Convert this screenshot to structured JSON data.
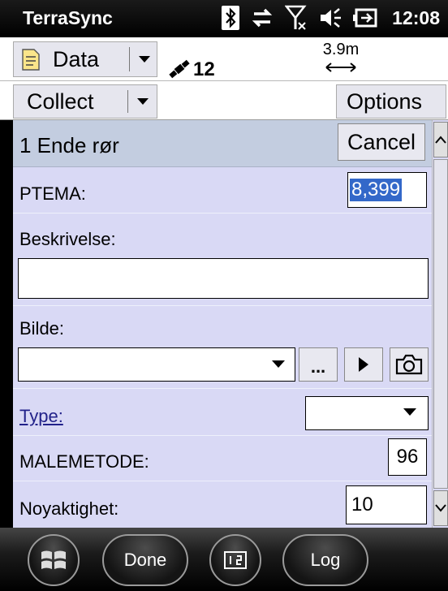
{
  "titlebar": {
    "app_title": "TerraSync",
    "time": "12:08"
  },
  "toolbar": {
    "data_label": "Data",
    "satellite_count": "12",
    "distance": "3.9m",
    "collect_label": "Collect",
    "options_label": "Options"
  },
  "form": {
    "title": "1 Ende rør",
    "cancel_label": "Cancel",
    "fields": {
      "ptema_label": "PTEMA:",
      "ptema_value": "8,399",
      "beskrivelse_label": "Beskrivelse:",
      "beskrivelse_value": "",
      "bilde_label": "Bilde:",
      "bilde_value": "",
      "browse_label": "...",
      "type_label": "Type:",
      "type_value": "",
      "malemetode_label": "MALEMETODE:",
      "malemetode_value": "96",
      "noyaktighet_label": "Noyaktighet:",
      "noyaktighet_value": "10"
    }
  },
  "bottombar": {
    "done_label": "Done",
    "log_label": "Log"
  },
  "colors": {
    "form_bg": "#d9d9f5",
    "header_bg": "#c3cde0",
    "selection": "#3368c9"
  },
  "icons": [
    "bluetooth-icon",
    "sync-arrows-icon",
    "no-signal-icon",
    "volume-icon",
    "battery-icon",
    "document-icon",
    "satellite-icon",
    "camera-icon",
    "play-icon",
    "windows-start-icon",
    "keyboard-icon"
  ]
}
